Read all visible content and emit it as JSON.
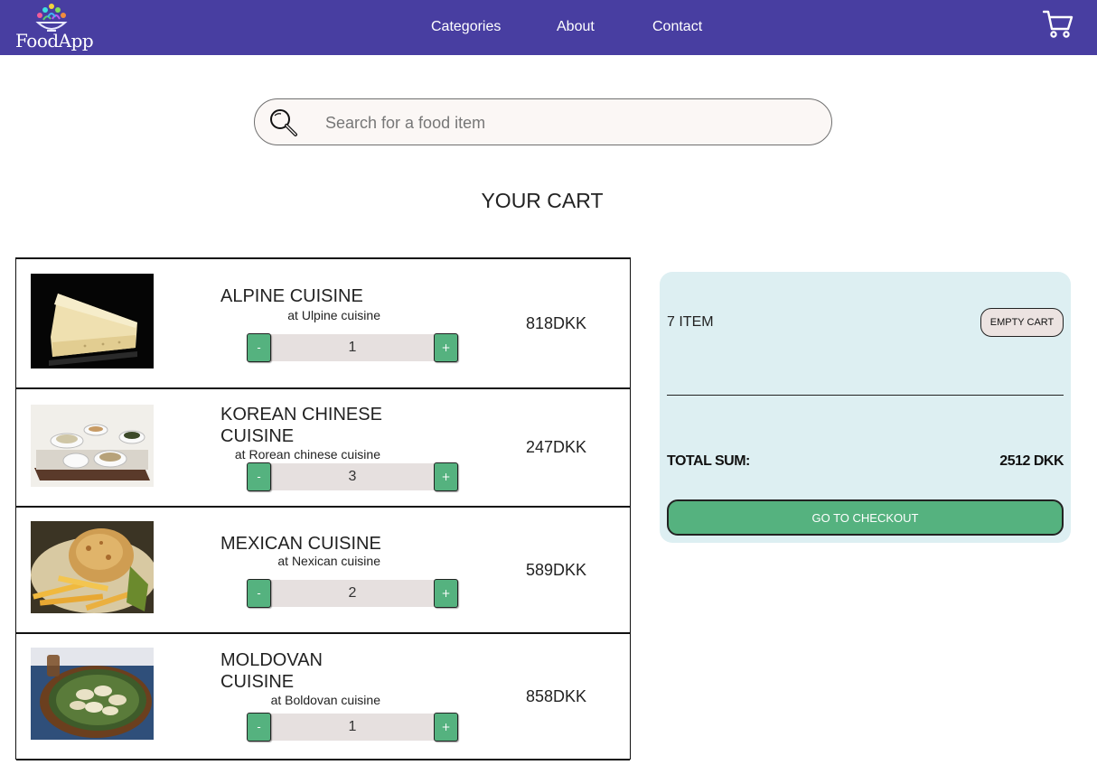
{
  "header": {
    "logo_text": "FoodApp",
    "nav": [
      {
        "label": "Categories"
      },
      {
        "label": "About"
      },
      {
        "label": "Contact"
      }
    ],
    "cart_icon": "shopping-cart-icon"
  },
  "search": {
    "placeholder": "Search for a food item",
    "value": "",
    "icon": "magnifier-icon"
  },
  "title": "YOUR CART",
  "cart": {
    "items": [
      {
        "name": "ALPINE CUISINE",
        "restaurant": "at Ulpine cuisine",
        "quantity": "1",
        "price": "818DKK",
        "minus": "-",
        "plus": "+",
        "image": "cheese-photo"
      },
      {
        "name": "KOREAN CHINESE CUISINE",
        "restaurant": "at Rorean chinese cuisine",
        "quantity": "3",
        "price": "247DKK",
        "minus": "-",
        "plus": "+",
        "image": "dumplings-tray-photo"
      },
      {
        "name": "MEXICAN CUISINE",
        "restaurant": "at Nexican cuisine",
        "quantity": "2",
        "price": "589DKK",
        "minus": "-",
        "plus": "+",
        "image": "crab-cake-fries-photo"
      },
      {
        "name": "MOLDOVAN CUISINE",
        "restaurant": "at Boldovan cuisine",
        "quantity": "1",
        "price": "858DKK",
        "minus": "-",
        "plus": "+",
        "image": "dumplings-plate-photo"
      }
    ]
  },
  "summary": {
    "item_count": "7 ITEM",
    "empty_label": "EMPTY CART",
    "total_label": "TOTAL SUM:",
    "total_value": "2512 DKK",
    "checkout_label": "GO TO CHECKOUT"
  },
  "colors": {
    "header_bg": "#483ea1",
    "button_green": "#55b27f",
    "summary_bg": "#ddeff2",
    "qty_bar": "#e6e0df"
  }
}
